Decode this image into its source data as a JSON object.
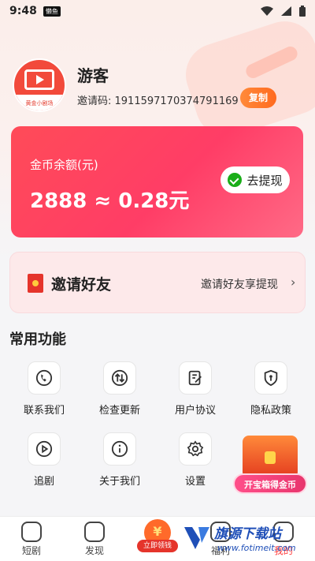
{
  "status_bar": {
    "time": "9:48",
    "app_badge": "懒鱼"
  },
  "profile": {
    "name": "游客",
    "invite_code": "邀请码: 1911597170374791169",
    "copy_label": "复制",
    "avatar_caption": "黄金小剧场"
  },
  "balance": {
    "label": "金币余额(元)",
    "amount": "2888 ≈ 0.28元",
    "withdraw_label": "去提现"
  },
  "invite": {
    "title": "邀请好友",
    "subtitle": "邀请好友享提现",
    "chevron": "›"
  },
  "common_functions": {
    "title": "常用功能",
    "items": [
      {
        "label": "联系我们",
        "icon": "phone-icon"
      },
      {
        "label": "检查更新",
        "icon": "update-icon"
      },
      {
        "label": "用户协议",
        "icon": "document-icon"
      },
      {
        "label": "隐私政策",
        "icon": "shield-icon"
      },
      {
        "label": "追剧",
        "icon": "play-icon"
      },
      {
        "label": "关于我们",
        "icon": "info-icon"
      },
      {
        "label": "设置",
        "icon": "gear-icon"
      }
    ]
  },
  "treasure": {
    "label": "开宝箱得金币"
  },
  "bottom_nav": {
    "items": [
      {
        "label": "短剧"
      },
      {
        "label": "发现"
      },
      {
        "label": "福利"
      },
      {
        "label": "我的"
      }
    ],
    "center_label": "立即领钱"
  },
  "watermark": {
    "title": "旗源下载站",
    "url": "www.fotimeit.com"
  },
  "colors": {
    "accent": "#ff3d66",
    "copy_button": "#ff7a2a",
    "active_tab": "#ff3d3d"
  }
}
